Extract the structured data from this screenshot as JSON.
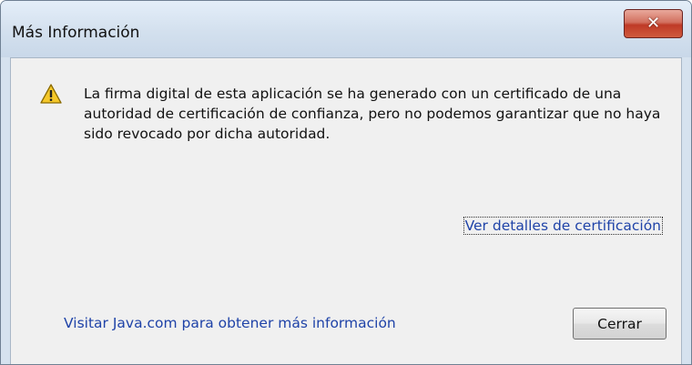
{
  "window": {
    "title": "Más Información",
    "close_icon_glyph": "✕"
  },
  "message": {
    "icon": "warning-icon",
    "text": "La firma digital de esta aplicación se ha generado con un certificado de una autoridad de certificación de confianza, pero no podemos garantizar que no haya sido revocado por dicha autoridad."
  },
  "links": {
    "details": "Ver detalles de certificación",
    "java": "Visitar Java.com para obtener más información"
  },
  "buttons": {
    "close_label": "Cerrar"
  },
  "colors": {
    "link": "#1f43a8",
    "close_button": "#c4412b",
    "frame": "#d6e2ef",
    "client": "#f0f0f0"
  }
}
